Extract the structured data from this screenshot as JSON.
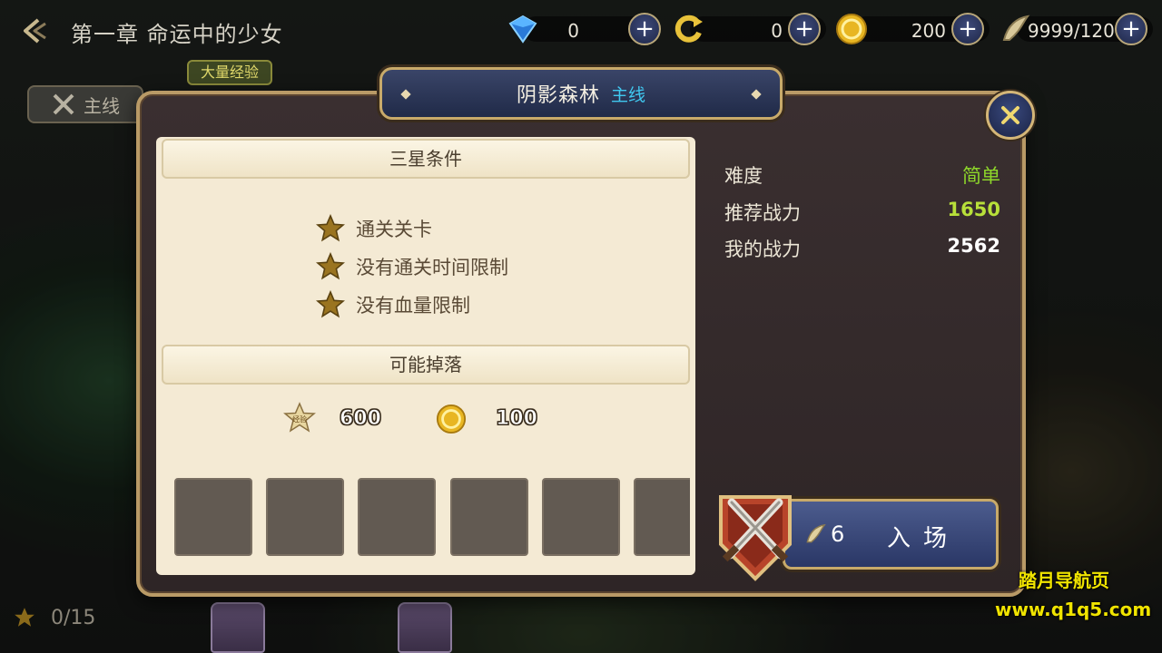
{
  "header": {
    "chapter_title": "第一章 命运中的少女",
    "resources": [
      {
        "name": "gem",
        "value": "0"
      },
      {
        "name": "refresh",
        "value": "0"
      },
      {
        "name": "gold",
        "value": "200"
      },
      {
        "name": "stamina",
        "value": "9999/120"
      }
    ]
  },
  "side": {
    "exp_tag": "大量经验",
    "tab_main": "主线"
  },
  "footer": {
    "stars": "0/15"
  },
  "dialog": {
    "title": "阴影森林",
    "subtitle": "主线",
    "three_star_header": "三星条件",
    "conditions": [
      "通关关卡",
      "没有通关时间限制",
      "没有血量限制"
    ],
    "drops_header": "可能掉落",
    "drops": {
      "exp_icon_label": "经验",
      "exp": "600",
      "gold": "100"
    },
    "info": {
      "difficulty_label": "难度",
      "difficulty_value": "简单",
      "recommended_label": "推荐战力",
      "recommended_value": "1650",
      "my_power_label": "我的战力",
      "my_power_value": "2562"
    },
    "enter": {
      "cost": "6",
      "label": "入场"
    }
  },
  "watermark": {
    "line1": "踏月导航页",
    "line2": "www.q1q5.com"
  },
  "colors": {
    "difficulty": "#8ed82a",
    "recommended": "#b8e03a",
    "subtitle": "#40c8f0",
    "watermark": "#f0e400"
  }
}
